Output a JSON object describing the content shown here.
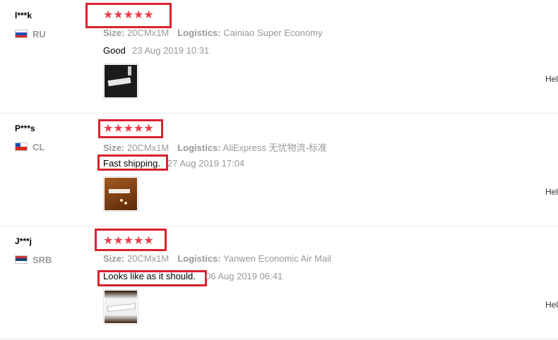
{
  "reviews": [
    {
      "user": "l***k",
      "country": "RU",
      "stars": "★★★★★",
      "size_label": "Size:",
      "size_value": "20CMx1M",
      "logistics_label": "Logistics:",
      "logistics_value": "Cainiao Super Economy",
      "comment": "Good",
      "date": "23 Aug 2019 10:31",
      "helpful": "Hel",
      "flag_colors": [
        "#ffffff",
        "#1f4fb8",
        "#d52b1e"
      ]
    },
    {
      "user": "P***s",
      "country": "CL",
      "stars": "★★★★★",
      "size_label": "Size:",
      "size_value": "20CMx1M",
      "logistics_label": "Logistics:",
      "logistics_value": "AliExpress 无忧物流-标准",
      "comment": "Fast shipping.",
      "date": "27 Aug 2019 17:04",
      "helpful": "Hel",
      "flag_colors": [
        "#ffffff",
        "#d52b1e"
      ]
    },
    {
      "user": "J***j",
      "country": "SRB",
      "stars": "★★★★★",
      "size_label": "Size:",
      "size_value": "20CMx1M",
      "logistics_label": "Logistics:",
      "logistics_value": "Yanwen Economic Air Mail",
      "comment": "Looks like as it should.",
      "date": "06 Aug 2019 06:41",
      "helpful": "Hel",
      "flag_colors": [
        "#c6363c",
        "#0c4076",
        "#ffffff"
      ]
    }
  ],
  "colors": {
    "star": "#ea3e4a",
    "highlight_box": "#d9232d",
    "muted_text": "#999999"
  }
}
